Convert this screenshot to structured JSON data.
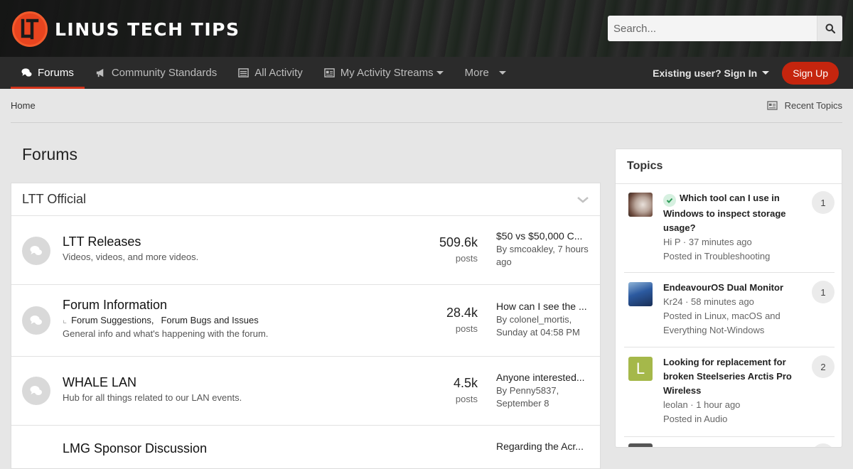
{
  "brand": {
    "name": "LINUS TECH TIPS",
    "accent": "#c5250e"
  },
  "search": {
    "placeholder": "Search..."
  },
  "nav": {
    "items": [
      {
        "label": "Forums",
        "icon": "comments-icon",
        "active": true
      },
      {
        "label": "Community Standards",
        "icon": "bullhorn-icon"
      },
      {
        "label": "All Activity",
        "icon": "list-icon"
      },
      {
        "label": "My Activity Streams",
        "icon": "newspaper-icon"
      },
      {
        "label": "More"
      }
    ],
    "signin": "Existing user? Sign In",
    "signup": "Sign Up"
  },
  "breadcrumb": {
    "home": "Home",
    "recent": "Recent Topics"
  },
  "page": {
    "title": "Forums"
  },
  "category": {
    "title": "LTT Official",
    "forums": [
      {
        "title": "LTT Releases",
        "desc": "Videos, videos, and more videos.",
        "count": "509.6k",
        "count_label": "posts",
        "last_title": "$50 vs $50,000 C...",
        "last_by": "By smcoakley, 7 hours ago"
      },
      {
        "title": "Forum Information",
        "sub1": "Forum Suggestions,",
        "sub2": "Forum Bugs and Issues",
        "desc": "General info and what's happening with the forum.",
        "count": "28.4k",
        "count_label": "posts",
        "last_title": "How can I see the ...",
        "last_by": "By colonel_mortis, Sunday at 04:58 PM"
      },
      {
        "title": "WHALE LAN",
        "desc": "Hub for all things related to our LAN events.",
        "count": "4.5k",
        "count_label": "posts",
        "last_title": "Anyone interested...",
        "last_by": "By Penny5837, September 8"
      },
      {
        "title": "LMG Sponsor Discussion",
        "last_title": "Regarding the Acr..."
      }
    ]
  },
  "sidebar": {
    "title": "Topics",
    "topics": [
      {
        "title": "Which tool can I use in Windows to inspect storage usage?",
        "meta": "Hi P · 37 minutes ago",
        "where": "Posted in Troubleshooting",
        "count": "1",
        "solved": true
      },
      {
        "title": "EndeavourOS Dual Monitor",
        "meta": "Kr24 · 58 minutes ago",
        "where": "Posted in Linux, macOS and Everything Not-Windows",
        "count": "1"
      },
      {
        "title": "Looking for replacement for broken Steelseries Arctis Pro Wireless",
        "meta": "leolan · 1 hour ago",
        "where": "Posted in Audio",
        "count": "2",
        "avatar_letter": "L"
      }
    ]
  }
}
